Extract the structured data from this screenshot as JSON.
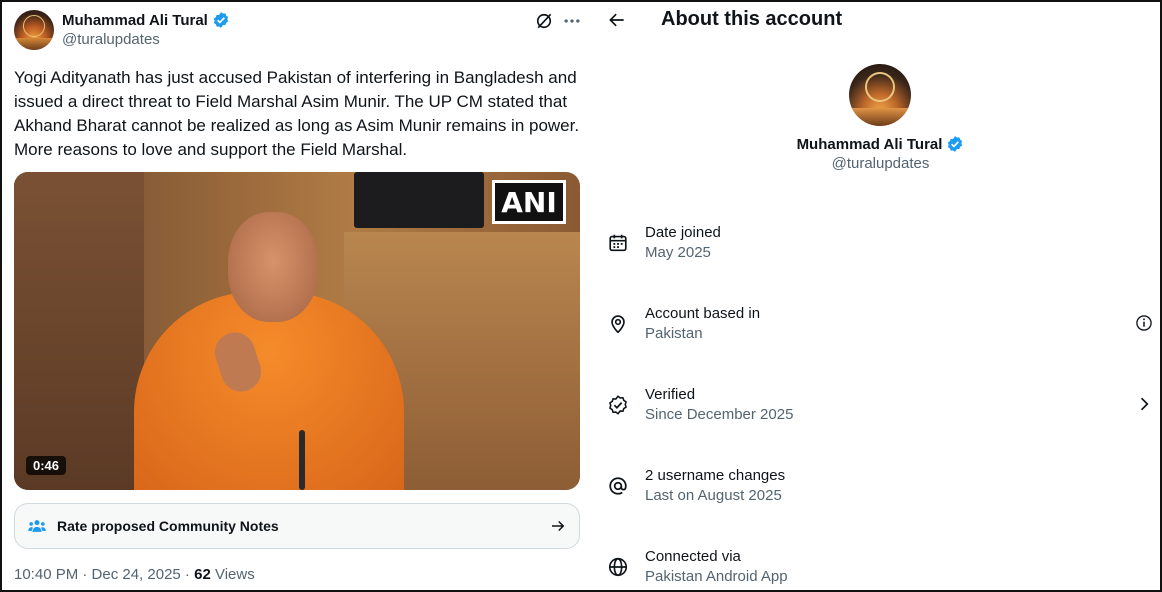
{
  "tweet": {
    "author_name": "Muhammad Ali Tural",
    "author_handle": "@turalupdates",
    "text": "Yogi Adityanath has just accused Pakistan of interfering in Bangladesh and issued a direct threat to Field Marshal Asim Munir. The UP CM stated that Akhand Bharat cannot be realized as long as Asim Munir remains in power. More reasons to love and support the Field Marshal.",
    "video_watermark": "ANI",
    "video_duration": "0:46",
    "community_notes_label": "Rate proposed Community Notes",
    "timestamp": "10:40 PM · Dec 24, 2025 · ",
    "views_count": "62",
    "views_label": " Views"
  },
  "about": {
    "title": "About this account",
    "name": "Muhammad Ali Tural",
    "handle": "@turalupdates",
    "rows": [
      {
        "label": "Date joined",
        "value": "May 2025",
        "icon": "calendar-icon"
      },
      {
        "label": "Account based in",
        "value": "Pakistan",
        "icon": "location-icon"
      },
      {
        "label": "Verified",
        "value": "Since December 2025",
        "icon": "verified-outline-icon"
      },
      {
        "label": "2 username changes",
        "value": "Last on August 2025",
        "icon": "at-icon"
      },
      {
        "label": "Connected via",
        "value": "Pakistan Android App",
        "icon": "globe-icon"
      }
    ]
  },
  "colors": {
    "verified_blue": "#1d9bf0",
    "secondary_text": "#536471",
    "primary_text": "#0f1419"
  }
}
